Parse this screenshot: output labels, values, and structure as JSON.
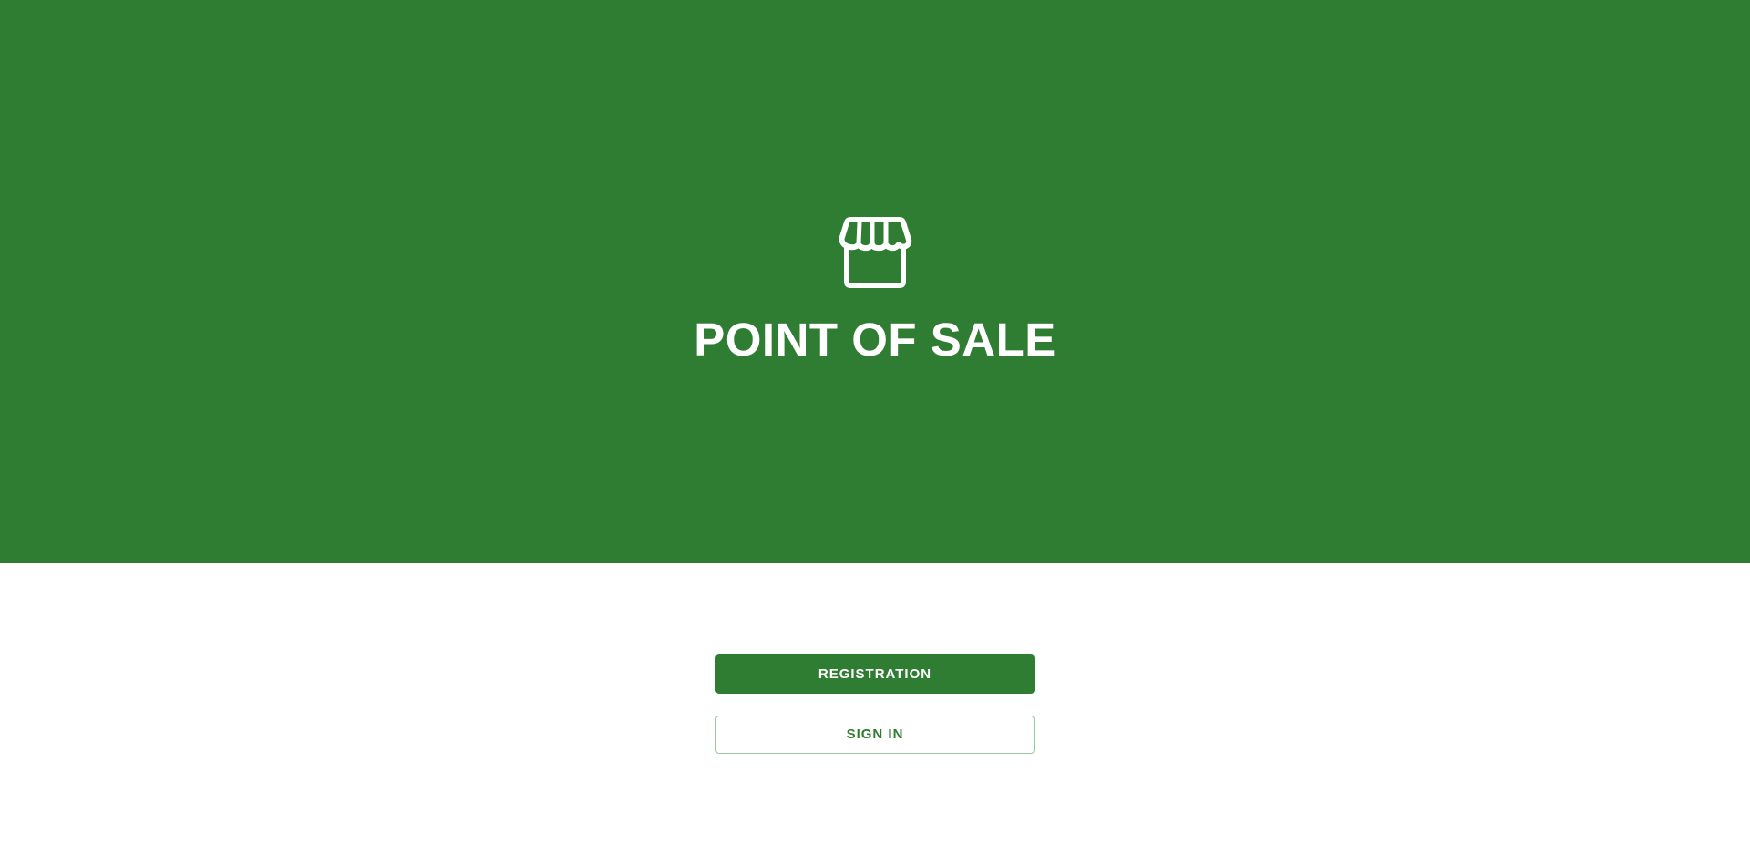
{
  "hero": {
    "title": "POINT OF SALE",
    "icon": "storefront-icon",
    "background_color": "#2f7d32"
  },
  "actions": {
    "registration_label": "REGISTRATION",
    "sign_in_label": "SIGN IN"
  },
  "colors": {
    "primary": "#2f7d32",
    "on_primary": "#ffffff",
    "outline_border": "#9cc79e"
  }
}
